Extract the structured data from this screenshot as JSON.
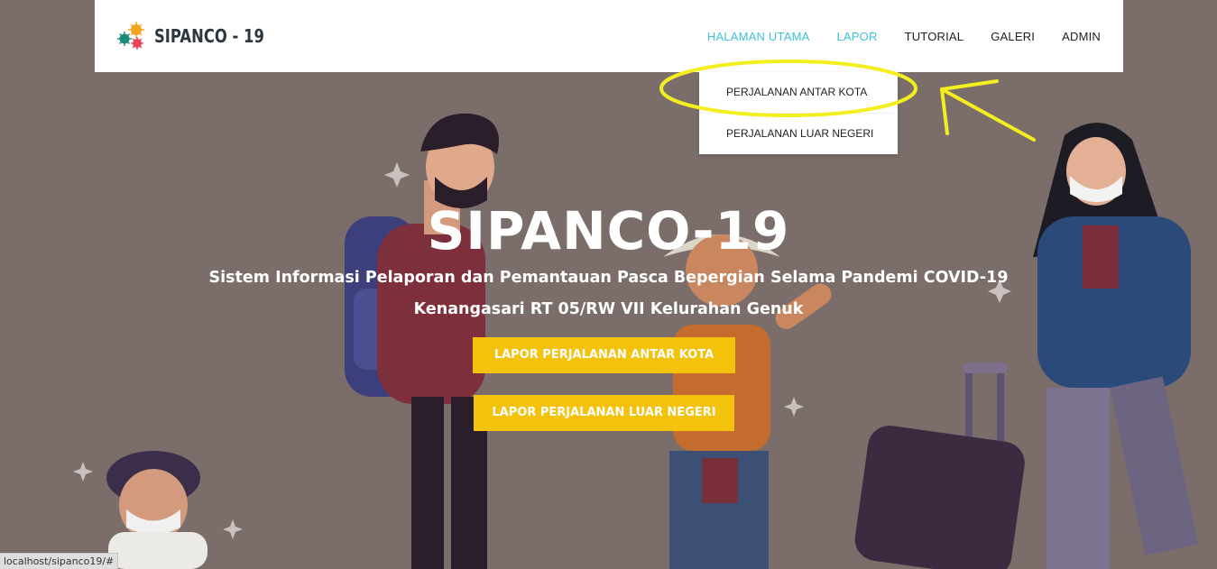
{
  "brand": {
    "name": "SIPANCO - 19",
    "logo": "virus-cluster-logo"
  },
  "nav": {
    "items": [
      {
        "label": "HALAMAN UTAMA",
        "state": "active"
      },
      {
        "label": "LAPOR",
        "state": "hover"
      },
      {
        "label": "TUTORIAL",
        "state": "normal"
      },
      {
        "label": "GALERI",
        "state": "normal"
      },
      {
        "label": "ADMIN",
        "state": "normal"
      }
    ]
  },
  "dropdown": {
    "items": [
      {
        "label": "PERJALANAN ANTAR KOTA"
      },
      {
        "label": "PERJALANAN LUAR NEGERI"
      }
    ]
  },
  "hero": {
    "title": "SIPANCO-19",
    "subtitle": "Sistem Informasi Pelaporan dan Pemantauan Pasca Bepergian Selama Pandemi COVID-19",
    "location": "Kenangasari RT 05/RW VII Kelurahan Genuk",
    "buttons": [
      {
        "label": "LAPOR PERJALANAN ANTAR KOTA"
      },
      {
        "label": "LAPOR PERJALANAN LUAR NEGERI"
      }
    ]
  },
  "status_bar": {
    "url": "localhost/sipanco19/#"
  },
  "colors": {
    "accent": "#3ec1d5",
    "cta": "#f4c10b",
    "hero_bg": "#7b6e6a",
    "annotation": "#f3ee1e"
  },
  "icons": [
    "virus-cluster-logo",
    "sparkle-icon"
  ]
}
